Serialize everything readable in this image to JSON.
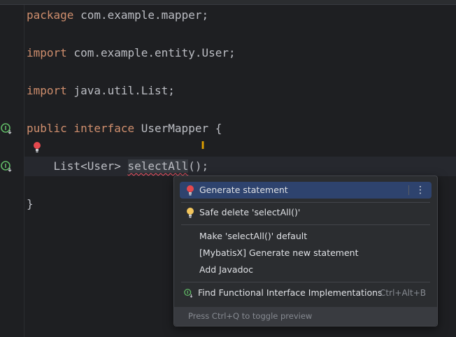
{
  "editor": {
    "lines": {
      "l1": {
        "kw": "package",
        "rest": " com.example.mapper;"
      },
      "l2": {
        "kw": "import",
        "rest": " com.example.entity.User;"
      },
      "l3": {
        "kw": "import",
        "rest": " java.util.List;"
      },
      "l4": {
        "kw": "public interface",
        "rest": " UserMapper {"
      },
      "l5": {
        "pre": "    List<User> ",
        "word": "selectAll",
        "post": "();"
      },
      "l6": {
        "text": "}"
      }
    },
    "gutter_icons": [
      "implementation-icon",
      "implementation-icon"
    ],
    "colors": {
      "background": "#1e1f22",
      "keyword": "#cf8e6d",
      "text": "#bcbec4",
      "error": "#f75464"
    }
  },
  "popup": {
    "items": {
      "generate": {
        "label": "Generate statement",
        "icon": "red-bulb-icon"
      },
      "safe_delete": {
        "label": "Safe delete 'selectAll()'",
        "icon": "yellow-bulb-icon"
      },
      "make_default": {
        "label": "Make 'selectAll()' default"
      },
      "mybatisx": {
        "label": "[MybatisX] Generate new statement"
      },
      "javadoc": {
        "label": "Add Javadoc"
      },
      "find_impl": {
        "label": "Find Functional Interface Implementations",
        "shortcut": "Ctrl+Alt+B",
        "icon": "implementation-icon"
      }
    },
    "footer": "Press Ctrl+Q to toggle preview",
    "colors": {
      "selected": "#2e436e",
      "background": "#2b2d30"
    }
  }
}
